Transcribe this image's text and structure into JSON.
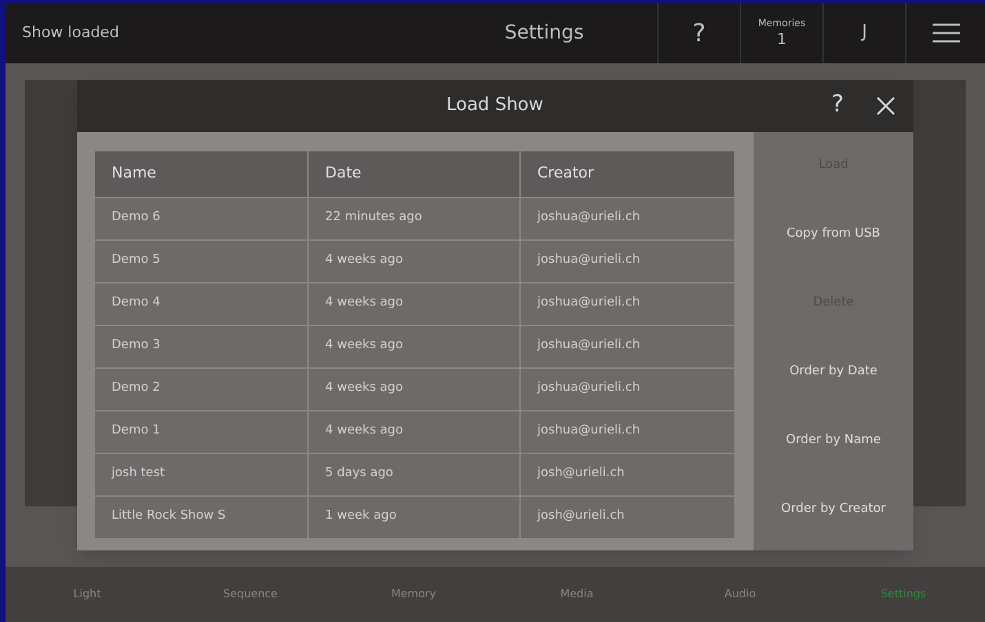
{
  "top_bar": {
    "status": "Show loaded",
    "title": "Settings",
    "help": "?",
    "memories_label": "Memories",
    "memories_count": "1",
    "user": "J"
  },
  "dialog": {
    "title": "Load Show",
    "help": "?",
    "table": {
      "columns": [
        "Name",
        "Date",
        "Creator"
      ],
      "rows": [
        [
          "Demo 6",
          "22 minutes ago",
          "joshua@urieli.ch"
        ],
        [
          "Demo 5",
          "4 weeks ago",
          "joshua@urieli.ch"
        ],
        [
          "Demo 4",
          "4 weeks ago",
          "joshua@urieli.ch"
        ],
        [
          "Demo 3",
          "4 weeks ago",
          "joshua@urieli.ch"
        ],
        [
          "Demo 2",
          "4 weeks ago",
          "joshua@urieli.ch"
        ],
        [
          "Demo 1",
          "4 weeks ago",
          "joshua@urieli.ch"
        ],
        [
          "josh test",
          "5 days ago",
          "josh@urieli.ch"
        ],
        [
          "Little Rock Show S",
          "1 week ago",
          "josh@urieli.ch"
        ]
      ]
    },
    "actions": [
      {
        "label": "Load",
        "disabled": true
      },
      {
        "label": "Copy from USB",
        "disabled": false
      },
      {
        "label": "Delete",
        "disabled": true
      },
      {
        "label": "Order by Date",
        "disabled": false
      },
      {
        "label": "Order by Name",
        "disabled": false
      },
      {
        "label": "Order by Creator",
        "disabled": false
      }
    ]
  },
  "nav_tabs": [
    {
      "label": "Light",
      "selected": false
    },
    {
      "label": "Sequence",
      "selected": false
    },
    {
      "label": "Memory",
      "selected": false
    },
    {
      "label": "Media",
      "selected": false
    },
    {
      "label": "Audio",
      "selected": false
    },
    {
      "label": "Settings",
      "selected": true
    }
  ]
}
